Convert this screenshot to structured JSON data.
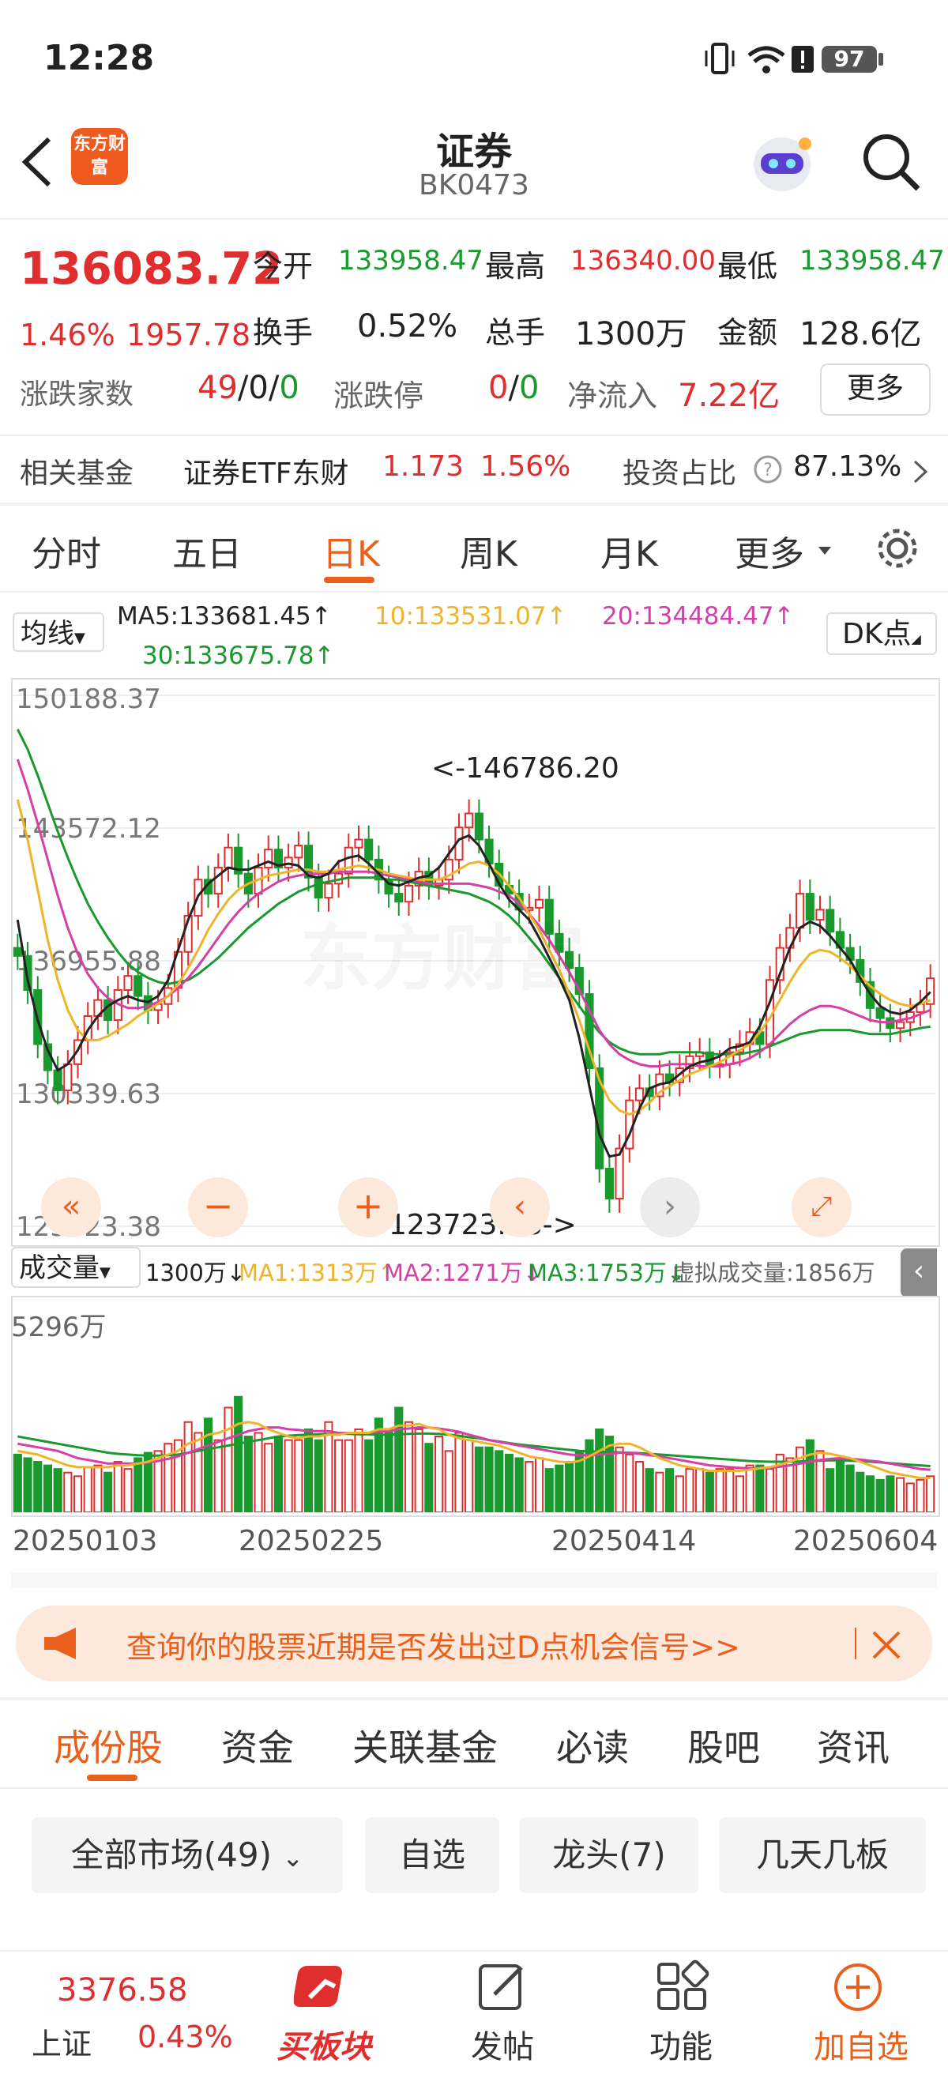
{
  "status_bar": {
    "time": "12:28",
    "battery": "97"
  },
  "header": {
    "logo_text": "东方财富",
    "title": "证券",
    "code": "BK0473"
  },
  "quote": {
    "price": "136083.72",
    "pct": "1.46%",
    "change": "1957.78",
    "open_label": "今开",
    "open": "133958.47",
    "high_label": "最高",
    "high": "136340.00",
    "low_label": "最低",
    "low": "133958.47",
    "turnover_label": "换手",
    "turnover": "0.52%",
    "volume_label": "总手",
    "volume": "1300万",
    "amount_label": "金额",
    "amount": "128.6亿",
    "updown_label": "涨跌家数",
    "up": "49",
    "flat": "/0/",
    "down": "0",
    "limit_label": "涨跌停",
    "limit_up": "0",
    "limit_sep": "/",
    "limit_down": "0",
    "netflow_label": "净流入",
    "netflow": "7.22亿",
    "more": "更多"
  },
  "fund_row": {
    "label": "相关基金",
    "fund_name": "证券ETF东财",
    "fund_price": "1.173",
    "fund_pct": "1.56%",
    "ratio_label": "投资占比",
    "ratio": "87.13%"
  },
  "period_tabs": [
    "分时",
    "五日",
    "日K",
    "周K",
    "月K",
    "更多"
  ],
  "active_tab": "日K",
  "ma_bar": {
    "selector": "均线",
    "ma5": "MA5:133681.45↑",
    "ma10": "10:133531.07↑",
    "ma20": "20:134484.47↑",
    "ma30": "30:133675.78↑",
    "dk": "DK点"
  },
  "colors": {
    "up": "#e02d2d",
    "down": "#1a9a2e",
    "ma5": "#222222",
    "ma10": "#f0b429",
    "ma20": "#d63fa8",
    "ma30": "#1a9a2e",
    "accent": "#e8601c"
  },
  "chart_data": {
    "type": "candlestick",
    "y_ticks": [
      "150188.37",
      "143572.12",
      "136955.88",
      "130339.63",
      "123723.38"
    ],
    "ylim": [
      123723.38,
      150188.37
    ],
    "max_label": "<-146786.20",
    "min_label": "123723.38->",
    "x_labels": [
      "20250103",
      "20250225",
      "20250414",
      "20250604"
    ],
    "close": [
      137200,
      135500,
      132800,
      131500,
      130500,
      131800,
      133000,
      134200,
      135000,
      134000,
      135500,
      136200,
      135200,
      134500,
      134800,
      135600,
      137400,
      139200,
      141000,
      140300,
      141600,
      142600,
      141300,
      140300,
      141600,
      142500,
      141600,
      142100,
      142700,
      141100,
      140100,
      140800,
      141300,
      142600,
      143000,
      142000,
      141000,
      140300,
      139900,
      140700,
      141400,
      140700,
      141000,
      142000,
      143600,
      144300,
      143000,
      141800,
      140700,
      140300,
      139500,
      139600,
      140000,
      138300,
      137400,
      136600,
      135300,
      131600,
      126600,
      125100,
      127600,
      130000,
      130600,
      130200,
      131300,
      130900,
      131600,
      132200,
      132400,
      131800,
      131800,
      132400,
      132800,
      133400,
      132800,
      136000,
      137600,
      138600,
      140300,
      139000,
      139500,
      138400,
      137600,
      137000,
      135900,
      134600,
      134100,
      133600,
      133900,
      134400,
      134800,
      136083
    ],
    "ma5": [
      139000,
      136000,
      134000,
      132500,
      131500,
      131800,
      132500,
      133500,
      134200,
      134700,
      135000,
      135200,
      135000,
      134900,
      135200,
      136000,
      137500,
      139000,
      140200,
      140800,
      141200,
      141600,
      141500,
      141500,
      141700,
      141900,
      141700,
      141800,
      141700,
      141200,
      141100,
      141300,
      141900,
      142100,
      142200,
      141800,
      141300,
      140800,
      140700,
      140900,
      141100,
      141200,
      141600,
      142300,
      143000,
      143200,
      142700,
      141800,
      140800,
      140000,
      139500,
      139000,
      138100,
      137100,
      136100,
      135000,
      133100,
      130700,
      128300,
      127200,
      127300,
      128300,
      129600,
      130600,
      130800,
      130900,
      131300,
      131700,
      131900,
      132000,
      132200,
      132600,
      132700,
      132900,
      133700,
      134900,
      136300,
      137600,
      138600,
      138900,
      138700,
      138200,
      137600,
      137000,
      136100,
      135300,
      134700,
      134400,
      134300,
      134500,
      134900,
      135400
    ],
    "ma10": [
      145000,
      143000,
      140500,
      138000,
      136000,
      134500,
      133500,
      133000,
      133000,
      133200,
      133500,
      133800,
      134200,
      134500,
      134800,
      135200,
      135800,
      136600,
      137500,
      138500,
      139300,
      140000,
      140500,
      140800,
      141000,
      141200,
      141300,
      141400,
      141500,
      141500,
      141400,
      141400,
      141500,
      141600,
      141700,
      141600,
      141500,
      141300,
      141200,
      141100,
      141000,
      141000,
      141000,
      141200,
      141500,
      141800,
      141900,
      141700,
      141300,
      140700,
      140100,
      139300,
      138500,
      137500,
      136500,
      135300,
      134000,
      132500,
      131000,
      130000,
      129500,
      129300,
      129500,
      129900,
      130400,
      130700,
      131000,
      131300,
      131500,
      131700,
      131900,
      132200,
      132500,
      132800,
      133400,
      134100,
      135000,
      135900,
      136700,
      137300,
      137500,
      137400,
      137100,
      136700,
      136200,
      135700,
      135300,
      135000,
      134800,
      134700,
      134800,
      135000
    ],
    "ma20": [
      147000,
      145500,
      143800,
      142000,
      140200,
      138600,
      137300,
      136300,
      135600,
      135100,
      134800,
      134600,
      134600,
      134700,
      134900,
      135200,
      135600,
      136100,
      136700,
      137400,
      138100,
      138800,
      139400,
      139900,
      140300,
      140600,
      140900,
      141100,
      141200,
      141300,
      141300,
      141300,
      141400,
      141400,
      141400,
      141400,
      141300,
      141200,
      141100,
      141000,
      140900,
      140800,
      140800,
      140800,
      140800,
      140800,
      140700,
      140600,
      140400,
      140200,
      139800,
      139300,
      138700,
      138000,
      137200,
      136400,
      135500,
      134500,
      133500,
      132800,
      132300,
      132000,
      131800,
      131700,
      131700,
      131800,
      131800,
      131800,
      131700,
      131700,
      131700,
      131800,
      131900,
      132100,
      132400,
      132800,
      133300,
      133800,
      134200,
      134500,
      134700,
      134700,
      134600,
      134400,
      134200,
      134000,
      133900,
      133900,
      134000,
      134100,
      134300,
      134500
    ],
    "ma30": [
      148500,
      147500,
      146200,
      144800,
      143400,
      142100,
      140900,
      139800,
      138900,
      138100,
      137400,
      136800,
      136400,
      136100,
      135900,
      135800,
      135900,
      136000,
      136300,
      136700,
      137100,
      137600,
      138100,
      138600,
      139000,
      139400,
      139800,
      140100,
      140400,
      140600,
      140800,
      140900,
      141000,
      141100,
      141100,
      141100,
      141100,
      141000,
      141000,
      140900,
      140800,
      140700,
      140600,
      140500,
      140400,
      140300,
      140100,
      139900,
      139600,
      139200,
      138700,
      138100,
      137500,
      136800,
      136100,
      135400,
      134700,
      134000,
      133400,
      132900,
      132600,
      132400,
      132300,
      132300,
      132300,
      132400,
      132400,
      132400,
      132400,
      132300,
      132300,
      132300,
      132300,
      132400,
      132500,
      132700,
      132900,
      133100,
      133300,
      133400,
      133500,
      133500,
      133500,
      133500,
      133400,
      133300,
      133300,
      133300,
      133400,
      133500,
      133600,
      133675
    ],
    "volume_header": {
      "selector": "成交量",
      "vol": "1300万↓",
      "ma1": "MA1:1313万↑",
      "ma2": "MA2:1271万↓",
      "ma3": "MA3:1753万↓",
      "virtual": "虚拟成交量:1856万"
    },
    "volume_max_label": "5296万",
    "volume": [
      1600,
      1500,
      1400,
      1300,
      1200,
      1100,
      1000,
      1250,
      1300,
      1100,
      1400,
      1200,
      1500,
      1650,
      1700,
      1900,
      2000,
      2500,
      2200,
      2600,
      2000,
      2900,
      3200,
      2100,
      2200,
      1900,
      2100,
      2000,
      2000,
      2300,
      2000,
      2500,
      2000,
      2000,
      2300,
      2000,
      2600,
      2300,
      2900,
      2500,
      2300,
      1900,
      2100,
      1700,
      2200,
      2000,
      1800,
      1800,
      1700,
      1600,
      1500,
      1400,
      1500,
      1200,
      1300,
      1400,
      1700,
      2000,
      2300,
      2100,
      1800,
      1600,
      1400,
      1200,
      1100,
      1200,
      1000,
      1200,
      1200,
      1100,
      1200,
      1200,
      1000,
      1300,
      1300,
      1200,
      1600,
      1500,
      1800,
      2000,
      1700,
      1200,
      1400,
      1300,
      1100,
      1000,
      900,
      1000,
      950,
      800,
      900,
      1000
    ],
    "vol_ma1": [
      1700,
      1650,
      1600,
      1500,
      1400,
      1300,
      1250,
      1250,
      1250,
      1250,
      1300,
      1300,
      1350,
      1400,
      1500,
      1600,
      1700,
      1900,
      2000,
      2150,
      2200,
      2300,
      2450,
      2500,
      2450,
      2300,
      2200,
      2100,
      2050,
      2100,
      2100,
      2150,
      2150,
      2200,
      2200,
      2200,
      2300,
      2300,
      2400,
      2400,
      2450,
      2350,
      2300,
      2150,
      2050,
      2000,
      1950,
      1900,
      1850,
      1750,
      1650,
      1550,
      1500,
      1450,
      1400,
      1380,
      1420,
      1550,
      1700,
      1850,
      1900,
      1900,
      1800,
      1650,
      1500,
      1400,
      1300,
      1250,
      1200,
      1150,
      1150,
      1150,
      1150,
      1180,
      1220,
      1250,
      1320,
      1400,
      1500,
      1600,
      1650,
      1620,
      1560,
      1500,
      1400,
      1300,
      1200,
      1100,
      1050,
      1000,
      950,
      950
    ],
    "vol_ma2": [
      1900,
      1850,
      1800,
      1750,
      1700,
      1600,
      1500,
      1450,
      1400,
      1350,
      1350,
      1350,
      1350,
      1380,
      1420,
      1480,
      1550,
      1650,
      1750,
      1850,
      1950,
      2050,
      2150,
      2250,
      2300,
      2350,
      2350,
      2300,
      2280,
      2250,
      2250,
      2250,
      2200,
      2200,
      2200,
      2200,
      2230,
      2250,
      2300,
      2320,
      2350,
      2350,
      2320,
      2280,
      2230,
      2150,
      2080,
      2000,
      1950,
      1900,
      1850,
      1800,
      1750,
      1700,
      1650,
      1600,
      1580,
      1580,
      1600,
      1620,
      1650,
      1650,
      1620,
      1580,
      1550,
      1500,
      1450,
      1400,
      1350,
      1300,
      1280,
      1250,
      1230,
      1220,
      1220,
      1230,
      1260,
      1300,
      1350,
      1400,
      1450,
      1480,
      1500,
      1480,
      1460,
      1430,
      1400,
      1350,
      1300,
      1250,
      1200,
      1180
    ],
    "vol_ma3": [
      2100,
      2050,
      2000,
      1950,
      1900,
      1850,
      1800,
      1750,
      1700,
      1650,
      1620,
      1600,
      1580,
      1570,
      1570,
      1580,
      1600,
      1650,
      1700,
      1750,
      1800,
      1850,
      1900,
      1950,
      2000,
      2050,
      2100,
      2120,
      2140,
      2150,
      2160,
      2170,
      2170,
      2170,
      2160,
      2160,
      2150,
      2150,
      2160,
      2170,
      2180,
      2180,
      2170,
      2150,
      2120,
      2080,
      2050,
      2000,
      1960,
      1920,
      1880,
      1850,
      1820,
      1790,
      1760,
      1730,
      1700,
      1690,
      1680,
      1670,
      1660,
      1650,
      1640,
      1620,
      1600,
      1580,
      1560,
      1540,
      1520,
      1500,
      1480,
      1460,
      1440,
      1420,
      1410,
      1400,
      1400,
      1400,
      1410,
      1420,
      1430,
      1440,
      1440,
      1430,
      1420,
      1400,
      1380,
      1360,
      1340,
      1320,
      1300,
      1280
    ]
  },
  "banner": {
    "text": "查询你的股票近期是否发出过D点机会信号>>"
  },
  "section_tabs": [
    "成份股",
    "资金",
    "关联基金",
    "必读",
    "股吧",
    "资讯"
  ],
  "active_section": "成份股",
  "filters": [
    "全部市场(49)",
    "自选",
    "龙头(7)",
    "几天几板"
  ],
  "bottom": {
    "index_value": "3376.58",
    "index_name": "上证",
    "index_pct": "0.43%",
    "buy_label": "买板块",
    "post_label": "发帖",
    "func_label": "功能",
    "add_label": "加自选"
  }
}
